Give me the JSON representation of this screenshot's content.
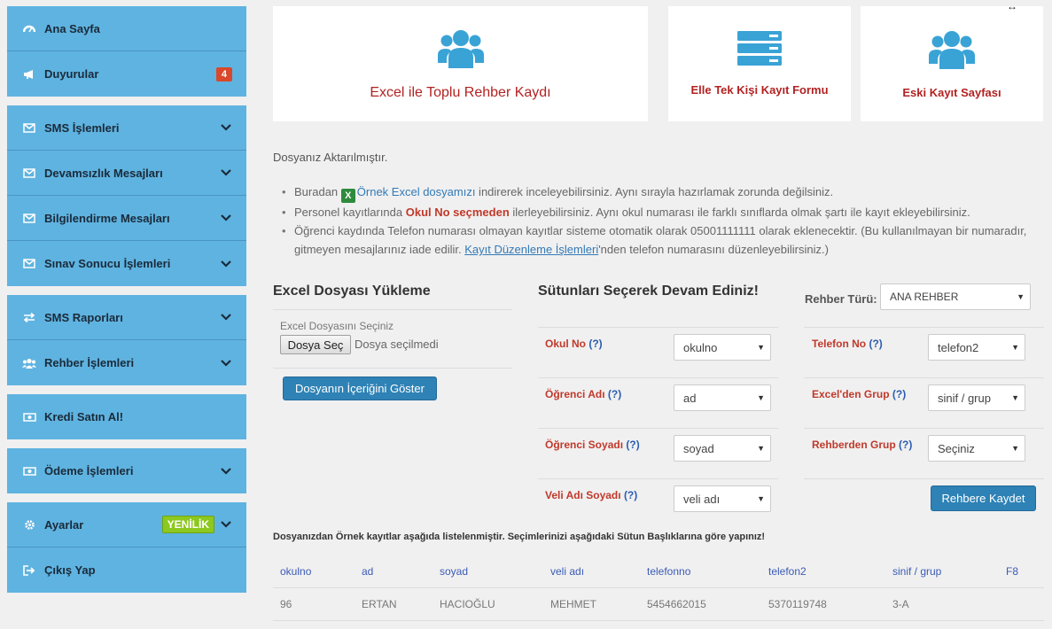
{
  "sidebar": {
    "groups": [
      [
        {
          "label": "Ana Sayfa",
          "icon": "dashboard-icon"
        },
        {
          "label": "Duyurular",
          "icon": "megaphone-icon",
          "badge": "4"
        }
      ],
      [
        {
          "label": "SMS İşlemleri",
          "icon": "envelope-icon"
        },
        {
          "label": "Devamsızlık Mesajları",
          "icon": "envelope-icon"
        },
        {
          "label": "Bilgilendirme Mesajları",
          "icon": "envelope-icon"
        },
        {
          "label": "Sınav Sonucu İşlemleri",
          "icon": "envelope-icon"
        }
      ],
      [
        {
          "label": "SMS Raporları",
          "icon": "exchange-icon"
        },
        {
          "label": "Rehber İşlemleri",
          "icon": "users-icon"
        }
      ],
      [
        {
          "label": "Kredi Satın Al!",
          "icon": "money-icon"
        }
      ],
      [
        {
          "label": "Ödeme İşlemleri",
          "icon": "money-icon"
        }
      ],
      [
        {
          "label": "Ayarlar",
          "icon": "gear-icon",
          "badge": "YENİLİK"
        },
        {
          "label": "Çıkış Yap",
          "icon": "logout-icon"
        }
      ]
    ]
  },
  "cards": {
    "excel": "Excel ile Toplu Rehber Kaydı",
    "manual": "Elle Tek Kişi Kayıt Formu",
    "old": "Eski Kayıt Sayfası"
  },
  "message": "Dosyanız Aktarılmıştır.",
  "bullets": {
    "b1_pre": "Buradan",
    "b1_link": "Örnek Excel dosyamızı",
    "b1_post": " indirerek inceleyebilirsiniz. Aynı sırayla hazırlamak zorunda değilsiniz.",
    "b2_pre": "Personel kayıtlarında ",
    "b2_red": "Okul No seçmeden",
    "b2_post": " ilerleyebilirsiniz. Aynı okul numarası ile farklı sınıflarda olmak şartı ile kayıt ekleyebilirsiniz.",
    "b3_pre": "Öğrenci kaydında Telefon numarası olmayan kayıtlar sisteme otomatik olarak 05001111111 olarak eklenecektir. (Bu kullanılmayan bir numaradır, gitmeyen mesajlarınız iade edilir. ",
    "b3_link": "Kayıt Düzenleme İşlemleri",
    "b3_post": "'nden telefon numarasını düzenleyebilirsiniz.)"
  },
  "upload": {
    "title": "Excel Dosyası Yükleme",
    "label": "Excel Dosyasını Seçiniz",
    "file_button": "Dosya Seç",
    "file_status": "Dosya seçilmedi",
    "show_button": "Dosyanın İçeriğini Göster"
  },
  "columns": {
    "title": "Sütunları Seçerek Devam Ediniz!",
    "rehber_label": "Rehber Türü:",
    "rehber_value": "ANA REHBER",
    "q": "(?)",
    "fields": [
      {
        "label": "Okul No",
        "value": "okulno"
      },
      {
        "label": "Öğrenci Adı",
        "value": "ad"
      },
      {
        "label": "Öğrenci Soyadı",
        "value": "soyad"
      },
      {
        "label": "Veli Adı Soyadı",
        "value": "veli adı"
      },
      {
        "label": "Telefon No",
        "value": "telefon2"
      },
      {
        "label": "Excel'den Grup",
        "value": "sinif / grup"
      },
      {
        "label": "Rehberden Grup",
        "value": "Seçiniz"
      }
    ],
    "save_button": "Rehbere Kaydet"
  },
  "note": "Dosyanızdan Örnek kayıtlar aşağıda listelenmiştir. Seçimlerinizi aşağıdaki Sütun Başlıklarına göre yapınız!",
  "table": {
    "headers": [
      "okulno",
      "ad",
      "soyad",
      "veli adı",
      "telefonno",
      "telefon2",
      "sinif / grup",
      "F8"
    ],
    "rows": [
      [
        "96",
        "ERTAN",
        "HACIOĞLU",
        "MEHMET",
        "5454662015",
        "5370119748",
        "3-A",
        ""
      ]
    ]
  },
  "colors": {
    "sidebar": "#5fb3e0",
    "accent": "#2e82b5",
    "alert": "#c0392b",
    "new_badge": "#8cc81e"
  }
}
